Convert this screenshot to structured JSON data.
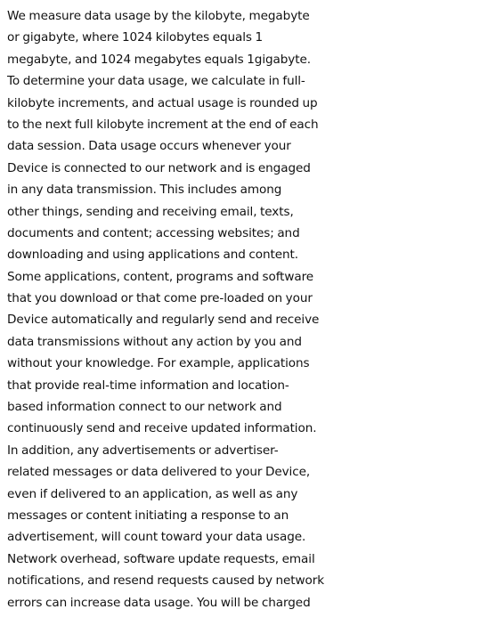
{
  "document": {
    "lines": [
      "We measure data usage by the kilobyte, megabyte",
      "or gigabyte, where 1024 kilobytes equals 1",
      "megabyte, and 1024 megabytes equals 1gigabyte.",
      "To determine your data usage, we calculate in full-",
      "kilobyte increments, and actual usage is rounded up",
      "to the next full kilobyte increment at the end of each",
      "data session. Data usage occurs whenever your",
      "Device is connected to our network and is engaged",
      "in any data transmission. This includes among",
      "other things, sending and receiving email, texts,",
      "documents and content; accessing websites; and",
      "downloading and using applications and content.",
      "Some applications, content, programs and software",
      "that you download or that come pre-loaded on your",
      "Device automatically and regularly send and receive",
      "data transmissions without any action by you and",
      "without your knowledge. For example, applications",
      "that provide real-time information and location-",
      "based information connect to our network and",
      "continuously send and receive updated information.",
      "In addition, any advertisements or advertiser-",
      "related messages or data delivered to your Device,",
      "even if delivered to an application, as well as any",
      "messages or content initiating a response to an",
      "advertisement, will count toward your data usage.",
      "Network overhead, software update requests, email",
      "notifications, and resend requests caused by network",
      "errors can increase data usage. You will be charged"
    ]
  }
}
